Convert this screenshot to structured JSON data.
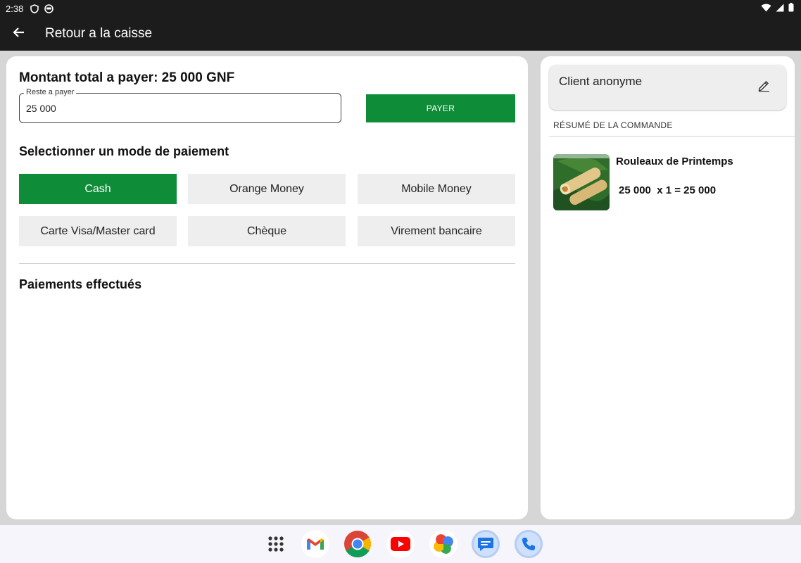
{
  "status_bar": {
    "time": "2:38",
    "icons": [
      "shield-icon",
      "face-icon",
      "wifi-icon",
      "signal-icon",
      "battery-icon"
    ]
  },
  "app_bar": {
    "title": "Retour a la caisse",
    "back_icon": "arrow-left-icon"
  },
  "payment": {
    "total_title": "Montant total a payer: 25 000 GNF",
    "remaining_label": "Reste a payer",
    "remaining_value": "25 000",
    "pay_button": "PAYER",
    "mode_title": "Selectionner un mode de paiement",
    "modes": [
      {
        "label": "Cash",
        "selected": true
      },
      {
        "label": "Orange Money",
        "selected": false
      },
      {
        "label": "Mobile Money",
        "selected": false
      },
      {
        "label": "Carte Visa/Master card",
        "selected": false
      },
      {
        "label": "Chèque",
        "selected": false
      },
      {
        "label": "Virement bancaire",
        "selected": false
      }
    ],
    "paid_title": "Paiements effectués"
  },
  "order": {
    "client_name": "Client anonyme",
    "edit_icon": "pencil-icon",
    "summary_label": "RÉSUMÉ DE LA COMMANDE",
    "items": [
      {
        "name": "Rouleaux de Printemps",
        "calc": "25 000  x 1 = 25 000"
      }
    ]
  },
  "dock": {
    "icons": [
      "app-grid-icon",
      "gmail-icon",
      "chrome-icon",
      "youtube-icon",
      "photos-icon",
      "messages-icon",
      "phone-icon"
    ]
  },
  "colors": {
    "accent_green": "#0f8c37",
    "bar_dark": "#1c1c1c",
    "button_gray": "#eeeeee"
  }
}
